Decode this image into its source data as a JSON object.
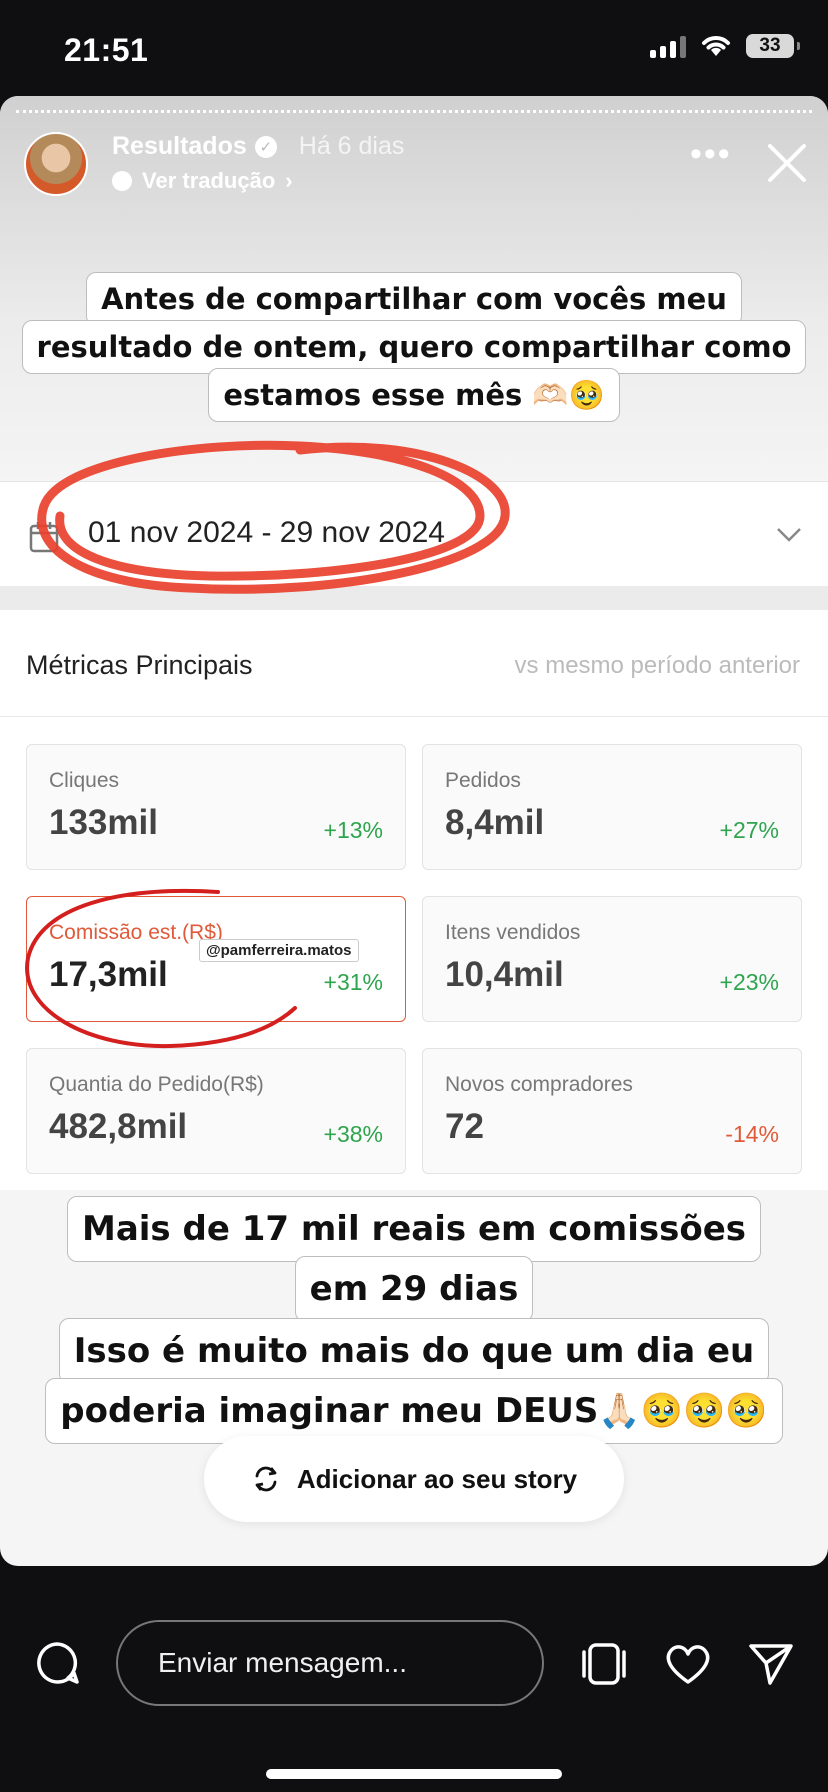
{
  "status": {
    "time": "21:51",
    "battery": "33"
  },
  "story": {
    "author": "Resultados",
    "time_ago": "Há 6 dias",
    "translate_label": "Ver tradução",
    "caption1_line1": "Antes de compartilhar com vocês meu",
    "caption1_line2": "resultado de ontem, quero compartilhar como",
    "caption1_line3": "estamos esse mês 🫶🏻🥹",
    "caption2_line1": "Mais de 17 mil reais em comissões",
    "caption2_line2": "em 29 dias",
    "caption3_line1": "Isso é muito mais do que um dia eu",
    "caption3_line2": "poderia imaginar meu DEUS🙏🏻🥹🥹🥹",
    "mention": "@pamferreira.matos",
    "add_story_label": "Adicionar ao seu story"
  },
  "dashboard": {
    "date_range": "01 nov 2024 - 29 nov 2024",
    "metrics_title": "Métricas Principais",
    "compare_label": "vs mesmo período anterior",
    "cards": [
      {
        "label": "Cliques",
        "value": "133mil",
        "delta": "+13%"
      },
      {
        "label": "Pedidos",
        "value": "8,4mil",
        "delta": "+27%"
      },
      {
        "label": "Comissão est.(R$)",
        "value": "17,3mil",
        "delta": "+31%"
      },
      {
        "label": "Itens vendidos",
        "value": "10,4mil",
        "delta": "+23%"
      },
      {
        "label": "Quantia do Pedido(R$)",
        "value": "482,8mil",
        "delta": "+38%"
      },
      {
        "label": "Novos compradores",
        "value": "72",
        "delta": "-14%"
      }
    ]
  },
  "bottom": {
    "message_placeholder": "Enviar mensagem..."
  },
  "colors": {
    "positive": "#2ea44f",
    "negative": "#e05a3a",
    "scribble": "#e8412c"
  }
}
